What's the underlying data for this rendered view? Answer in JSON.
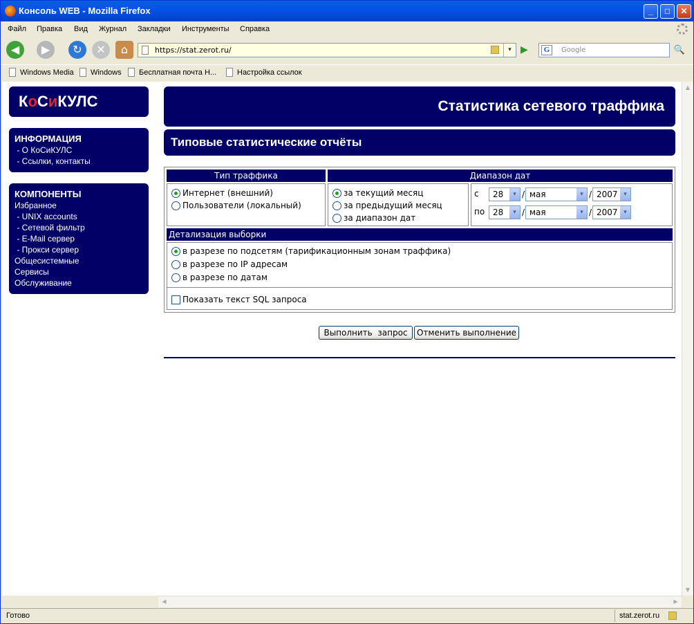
{
  "window": {
    "title": "Консоль WEB - Mozilla Firefox",
    "min_glyph": "_",
    "max_glyph": "□",
    "close_glyph": "✕"
  },
  "menu": [
    "Файл",
    "Правка",
    "Вид",
    "Журнал",
    "Закладки",
    "Инструменты",
    "Справка"
  ],
  "nav": {
    "url": "https://stat.zerot.ru/",
    "search_placeholder": "Google",
    "google_letter": "G",
    "back_glyph": "◀",
    "forward_glyph": "▶",
    "reload_glyph": "↻",
    "stop_glyph": "✕",
    "home_glyph": "⌂",
    "go_glyph": "▶",
    "dropdown_glyph": "▾",
    "search_glyph": "🔍"
  },
  "bookmarks": [
    "Windows Media",
    "Windows",
    "Бесплатная почта H...",
    "Настройка ссылок"
  ],
  "sidebar": {
    "logo": {
      "p1": "К",
      "p2": "о",
      "p3": "С",
      "p4": "и",
      "p5": "КУЛС"
    },
    "info": {
      "heading": "ИНФОРМАЦИЯ",
      "links": [
        " - О КоСиКУЛС",
        " - Ссылки, контакты"
      ]
    },
    "components": {
      "heading": "КОМПОНЕНТЫ",
      "links": [
        "Избранное",
        " - UNIX accounts",
        " - Сетевой фильтр",
        " - E-Mail сервер",
        " - Прокси сервер",
        "Общесистемные",
        "Сервисы",
        "Обслуживание"
      ]
    }
  },
  "main": {
    "banner_title": "Статистика сетевого траффика",
    "page_title": "Типовые статистические отчёты",
    "traffic": {
      "header": "Тип траффика",
      "options": [
        "Интернет (внешний)",
        "Пользователи (локальный)"
      ],
      "selected": 0
    },
    "dates": {
      "header": "Диапазон дат",
      "options": [
        "за текущий месяц",
        "за предыдущий месяц",
        "за диапазон дат"
      ],
      "selected": 0,
      "from_label": "с",
      "to_label": "по",
      "from": {
        "day": "28",
        "month": "мая",
        "year": "2007"
      },
      "to": {
        "day": "28",
        "month": "мая",
        "year": "2007"
      },
      "sep": "/"
    },
    "detail": {
      "header": "Детализация выборки",
      "options": [
        "в разрезе по подсетям (тарификационным зонам траффика)",
        "в разрезе по IP адресам",
        "в разрезе по датам"
      ],
      "selected": 0,
      "show_sql": "Показать текст SQL запроса"
    },
    "buttons": {
      "run": "Выполнить  запрос",
      "cancel": "Отменить выполнение"
    }
  },
  "status": {
    "left": "Готово",
    "right": "stat.zerot.ru"
  }
}
